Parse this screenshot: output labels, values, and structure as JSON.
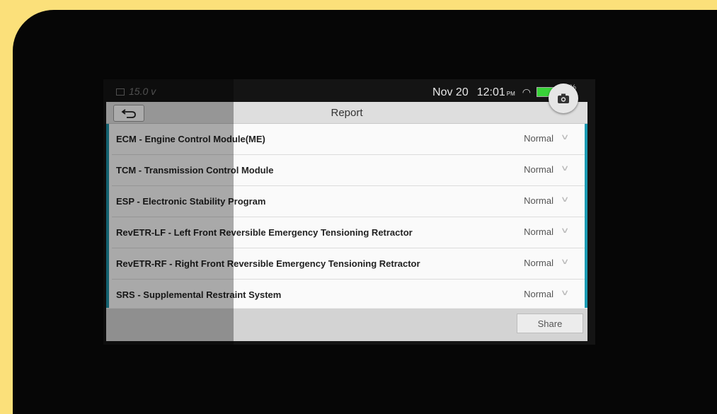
{
  "status_bar": {
    "voltage": "15.0",
    "voltage_unit": "v",
    "date": "Nov 20",
    "time": "12:01",
    "ampm": "PM",
    "battery_level_visible": "%",
    "battery_color": "#39d339"
  },
  "camera": {
    "icon": "camera-icon"
  },
  "header": {
    "title": "Report",
    "back_icon": "back-arrow-icon"
  },
  "modules": [
    {
      "label": "ECM - Engine Control Module(ME)",
      "status": "Normal"
    },
    {
      "label": "TCM - Transmission Control Module",
      "status": "Normal"
    },
    {
      "label": "ESP - Electronic Stability Program",
      "status": "Normal"
    },
    {
      "label": "RevETR-LF - Left Front Reversible Emergency Tensioning Retractor",
      "status": "Normal"
    },
    {
      "label": "RevETR-RF - Right Front Reversible Emergency Tensioning Retractor",
      "status": "Normal"
    },
    {
      "label": "SRS - Supplemental Restraint System",
      "status": "Normal"
    }
  ],
  "footer": {
    "share_label": "Share"
  },
  "colors": {
    "accent": "#1b9cb5",
    "frame": "#fbe07a"
  }
}
